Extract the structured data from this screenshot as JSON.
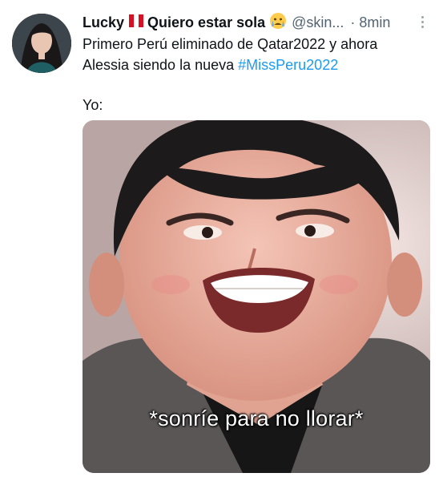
{
  "tweet": {
    "display_name": "Lucky",
    "flag_icon": "peru-flag-icon",
    "name_suffix": "Quiero estar sola",
    "emoji_icon": "crying-face-icon",
    "handle": "@skin...",
    "time": "· 8min",
    "text_line1": "Primero Perú eliminado de Qatar2022 y ahora",
    "text_line2": "Alessia siendo la nueva",
    "hashtag": "#MissPeru2022",
    "text_line3": "Yo:",
    "media_caption": "*sonríe para no llorar*"
  },
  "colors": {
    "hashtag": "#1d9bf0",
    "secondary_text": "#536471",
    "flag_red": "#d91023"
  }
}
